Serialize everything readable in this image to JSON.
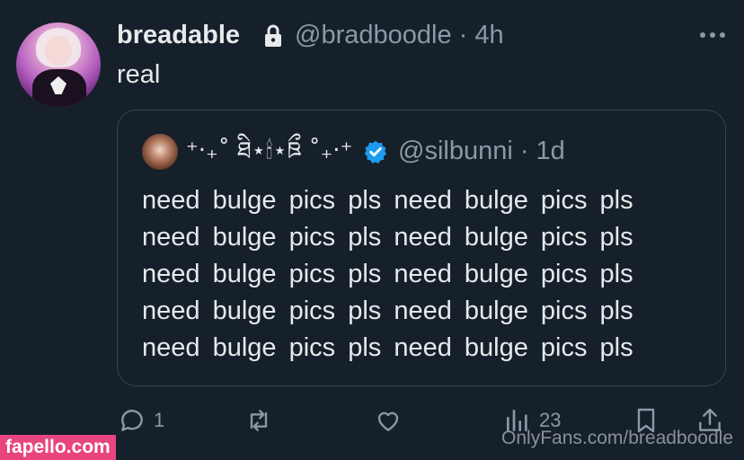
{
  "tweet": {
    "display_name": "breadable",
    "handle_time": "@bradboodle · 4h",
    "text": "real"
  },
  "quoted_tweet": {
    "display_name": "⁺‧₊˚ ཐི⋆🕯⋆ཋྀ ˚₊‧⁺",
    "handle_time": "@silbunni · 1d",
    "lines": [
      "need bulge pics pls need bulge pics pls",
      "need bulge pics pls need bulge pics pls",
      "need bulge pics pls need bulge pics pls",
      "need bulge pics pls need bulge pics pls",
      "need bulge pics pls need bulge pics pls"
    ]
  },
  "actions": {
    "reply_count": "1",
    "retweet_count": "",
    "like_count": "",
    "views_count": "23"
  },
  "overlays": {
    "site_watermark": "fapello.com",
    "onlyfans_watermark": "OnlyFans.com/breadboodle"
  },
  "colors": {
    "background": "#15202b",
    "text": "#e7e9ea",
    "muted": "#8b98a5",
    "verified": "#1d9bf0",
    "watermark": "#e8457f"
  }
}
